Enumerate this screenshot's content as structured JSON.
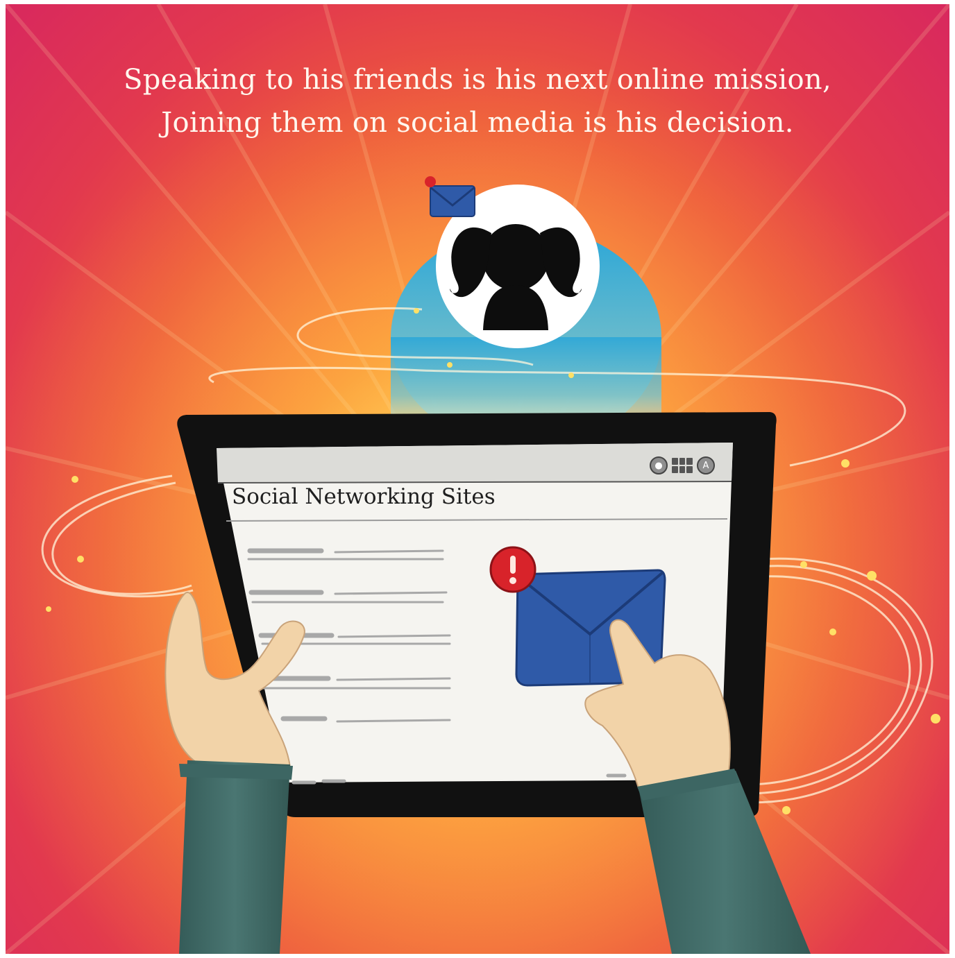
{
  "caption": {
    "line1": "Speaking to his friends is his next online mission,",
    "line2": "Joining them on social media is his decision."
  },
  "tablet": {
    "site_title": "Social Networking Sites",
    "toolbar": {
      "icons": [
        "bell-icon",
        "apps-grid-icon",
        "account-icon"
      ],
      "account_letter": "A"
    },
    "notification_alert": "!"
  },
  "friend_avatar": {
    "icon": "girl-silhouette-icon",
    "badge_icon": "envelope-icon"
  },
  "colors": {
    "envelope": "#2f5aa8",
    "alert": "#d8232a",
    "sleeve": "#3f6a66",
    "skin": "#f2d3a8",
    "tablet_frame": "#111111"
  }
}
